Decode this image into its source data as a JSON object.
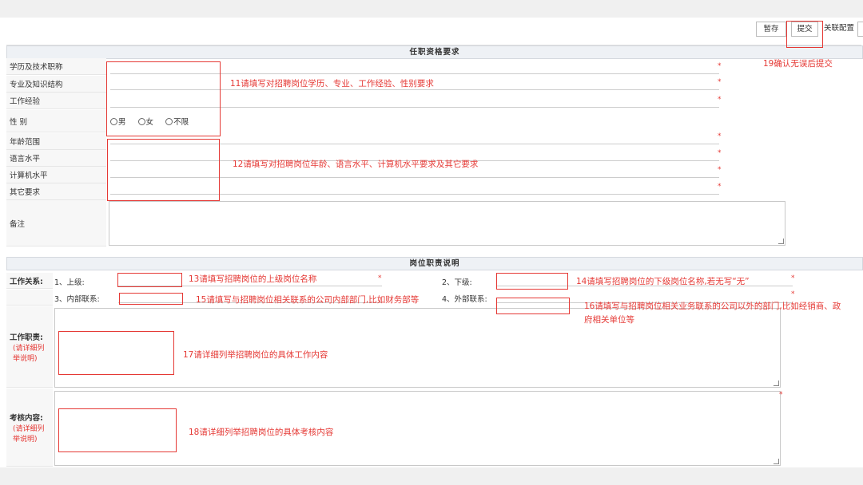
{
  "toolbar": {
    "save_label": "暂存",
    "submit_label": "提交",
    "config_label": "关联配置"
  },
  "qualifications": {
    "header": "任职资格要求",
    "rows": {
      "education": "学历及技术职称",
      "knowledge": "专业及知识结构",
      "experience": "工作经验",
      "gender": "性  别",
      "age": "年龄范围",
      "language": "语言水平",
      "computer": "计算机水平",
      "other": "其它要求",
      "remark": "备注"
    },
    "gender_options": {
      "male": "男",
      "female": "女",
      "any": "不限"
    }
  },
  "duties": {
    "header": "岗位职责说明",
    "work_relation": "工作关系:",
    "superior": "1、上级:",
    "subordinate": "2、下级:",
    "internal": "3、内部联系:",
    "external": "4、外部联系:",
    "responsibilities_title": "工作职责:",
    "responsibilities_note": "(请详细列举说明)",
    "assessment_title": "考核内容:",
    "assessment_note": "(请详细列举说明)"
  },
  "annotations": {
    "a11": "11请填写对招聘岗位学历、专业、工作经验、性别要求",
    "a12": "12请填写对招聘岗位年龄、语言水平、计算机水平要求及其它要求",
    "a13": "13请填写招聘岗位的上级岗位名称",
    "a14": "14请填写招聘岗位的下级岗位名称,若无写“无”",
    "a15": "15请填写与招聘岗位相关联系的公司内部部门,比如财务部等",
    "a16_line1": "16请填写与招聘岗位相关业务联系的公司以外的部门,比如经销商、政",
    "a16_line2": "府相关单位等",
    "a17": "17请详细列举招聘岗位的具体工作内容",
    "a18": "18请详细列举招聘岗位的具体考核内容",
    "a19": "19确认无误后提交"
  },
  "colors": {
    "annotation": "#e53935",
    "header_bg": "#eef1f5"
  }
}
